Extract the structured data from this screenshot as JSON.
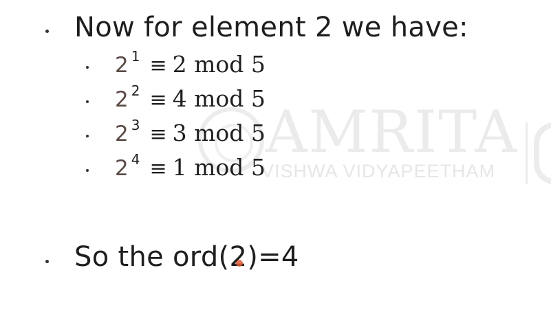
{
  "slide": {
    "heading": "Now for element 2 we have:",
    "powers": [
      {
        "base": "2",
        "exp": "1",
        "rel": "≡",
        "result": "2 mod 5"
      },
      {
        "base": "2",
        "exp": "2",
        "rel": "≡",
        "result": "4 mod 5"
      },
      {
        "base": "2",
        "exp": "3",
        "rel": "≡",
        "result": "3 mod 5"
      },
      {
        "base": "2",
        "exp": "4",
        "rel": "≡",
        "result": "1 mod 5"
      }
    ],
    "conclusion": "So the ord(2)=4"
  },
  "watermark": {
    "name": "AMRITA",
    "subtitle": "VISHWA VIDYAPEETHAM"
  },
  "colors": {
    "text": "#1e1e1e",
    "base_number": "#5a4a45",
    "cursor_marker": "#e05a3a",
    "watermark": "#ebebeb"
  }
}
